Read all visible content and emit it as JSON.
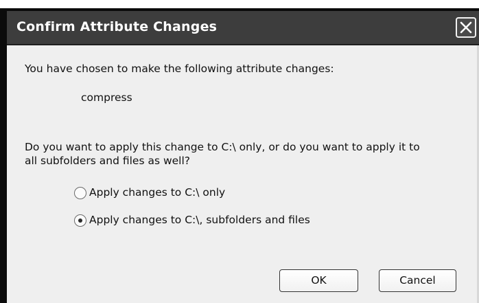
{
  "dialog": {
    "title": "Confirm Attribute Changes",
    "close_icon": "close-icon",
    "intro_text": "You have chosen to make the following attribute changes:",
    "change_item": "compress",
    "question_line1": "Do you want to apply this change to C:\\ only, or do you want to apply it to",
    "question_line2": "all subfolders and files as well?",
    "options": [
      {
        "label": "Apply changes to C:\\ only",
        "selected": false
      },
      {
        "label": "Apply changes to C:\\, subfolders and files",
        "selected": true
      }
    ],
    "ok_label": "OK",
    "cancel_label": "Cancel"
  }
}
